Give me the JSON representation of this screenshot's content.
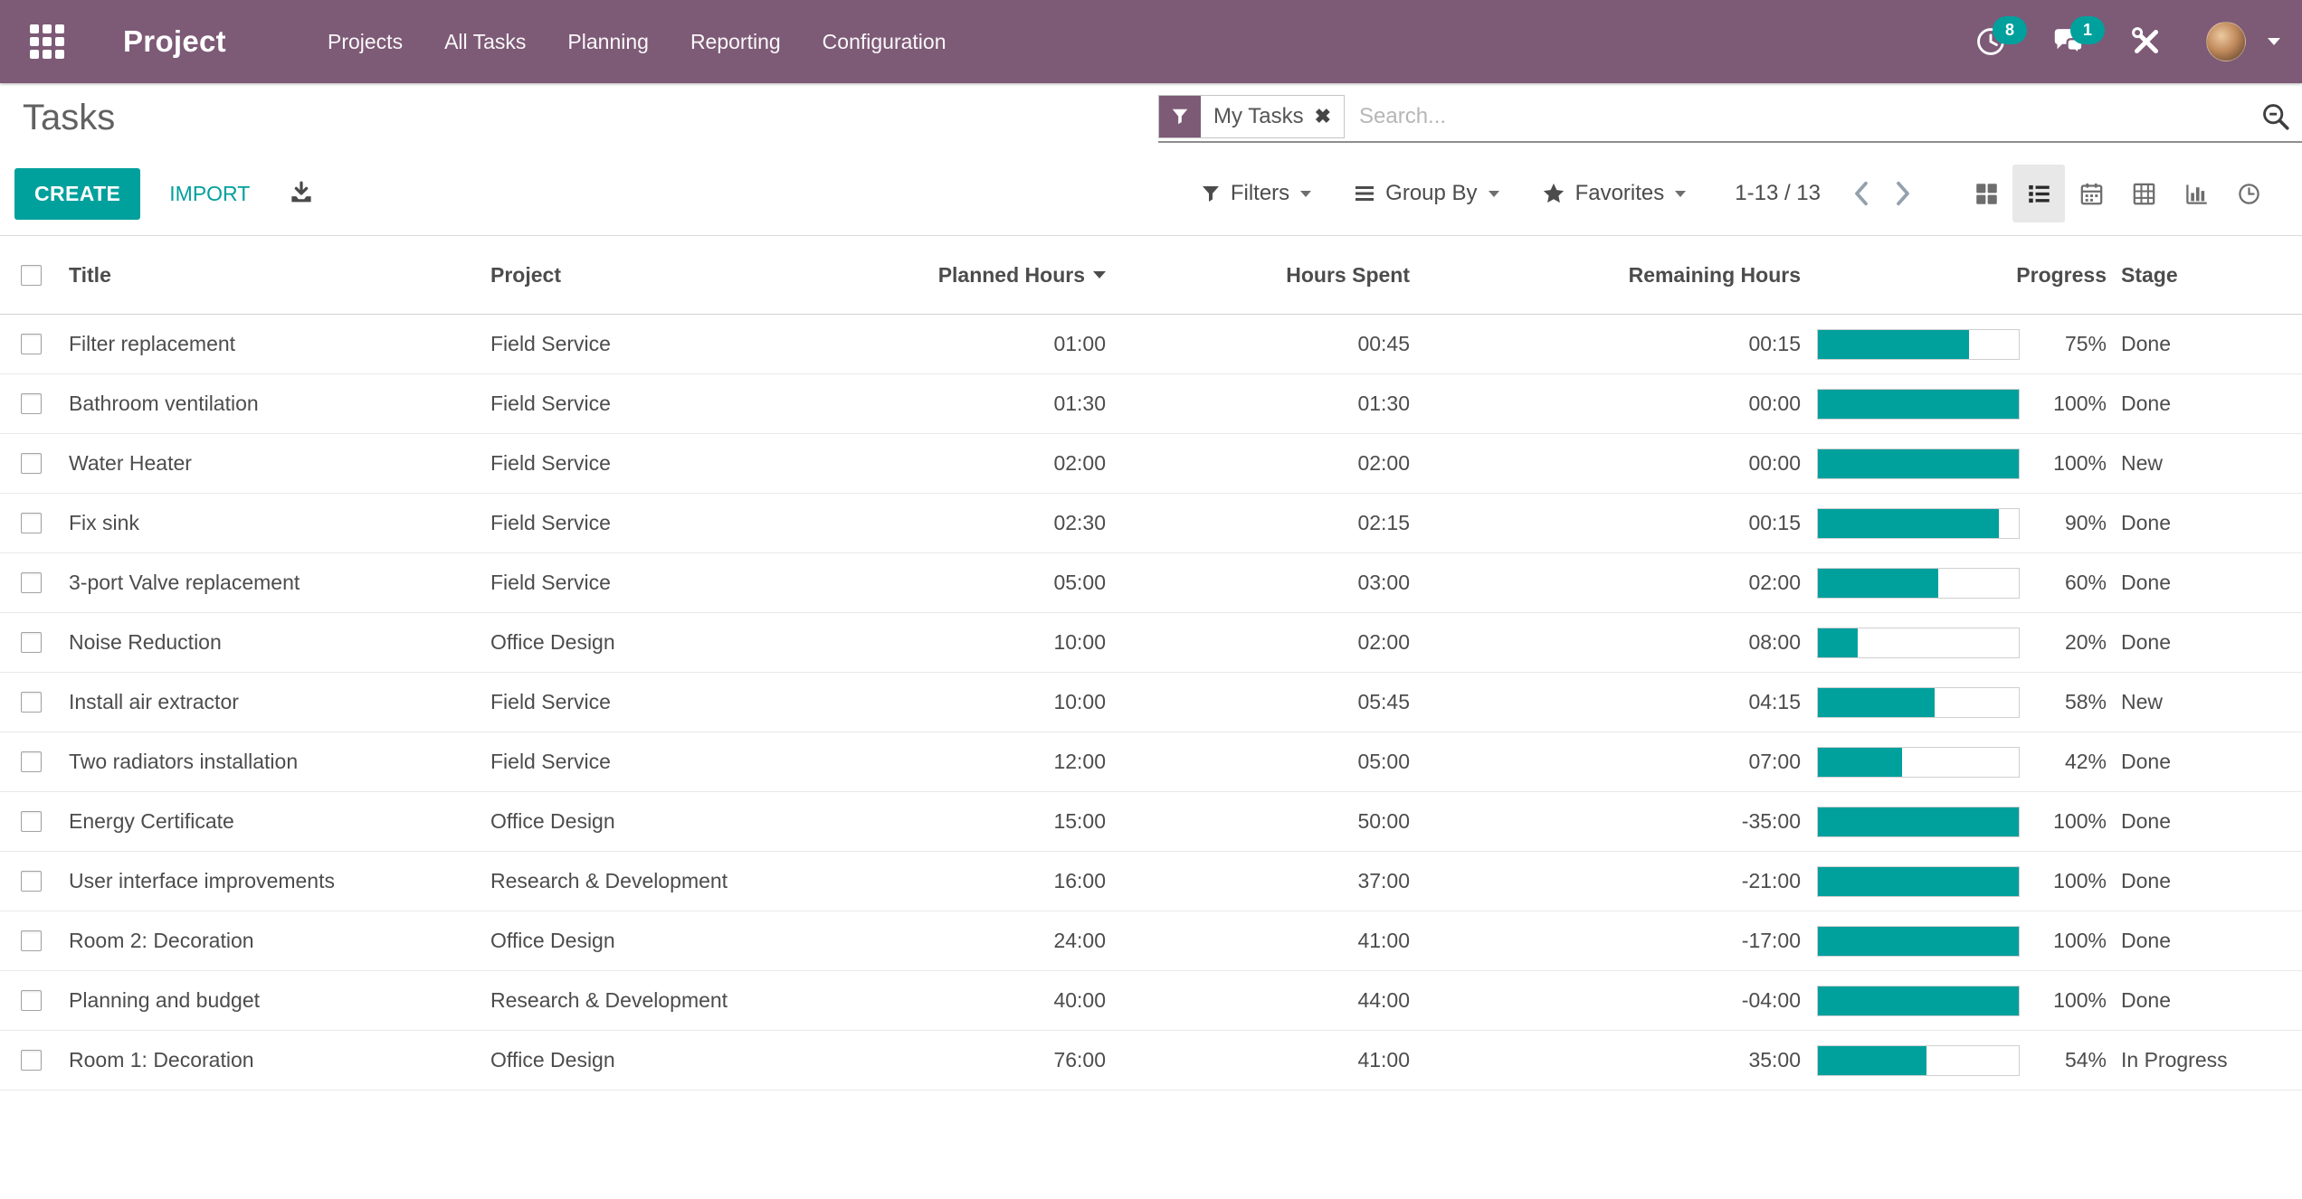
{
  "navbar": {
    "brand": "Project",
    "menus": [
      "Projects",
      "All Tasks",
      "Planning",
      "Reporting",
      "Configuration"
    ],
    "badges": {
      "activities": "8",
      "messages": "1"
    }
  },
  "control_panel": {
    "breadcrumb": "Tasks",
    "search": {
      "facet": "My Tasks",
      "placeholder": "Search..."
    },
    "buttons": {
      "create": "CREATE",
      "import": "IMPORT"
    },
    "dropdowns": {
      "filters": "Filters",
      "group_by": "Group By",
      "favorites": "Favorites"
    },
    "pager": {
      "range": "1-13 / 13"
    }
  },
  "table": {
    "headers": {
      "title": "Title",
      "project": "Project",
      "planned": "Planned Hours",
      "spent": "Hours Spent",
      "remaining": "Remaining Hours",
      "progress": "Progress",
      "stage": "Stage"
    },
    "sorted_by": "Planned Hours",
    "sort_direction": "desc",
    "rows": [
      {
        "title": "Filter replacement",
        "project": "Field Service",
        "planned": "01:00",
        "spent": "00:45",
        "remaining": "00:15",
        "progress": 75,
        "progress_label": "75%",
        "stage": "Done"
      },
      {
        "title": "Bathroom ventilation",
        "project": "Field Service",
        "planned": "01:30",
        "spent": "01:30",
        "remaining": "00:00",
        "progress": 100,
        "progress_label": "100%",
        "stage": "Done"
      },
      {
        "title": "Water Heater",
        "project": "Field Service",
        "planned": "02:00",
        "spent": "02:00",
        "remaining": "00:00",
        "progress": 100,
        "progress_label": "100%",
        "stage": "New"
      },
      {
        "title": "Fix sink",
        "project": "Field Service",
        "planned": "02:30",
        "spent": "02:15",
        "remaining": "00:15",
        "progress": 90,
        "progress_label": "90%",
        "stage": "Done"
      },
      {
        "title": "3-port Valve replacement",
        "project": "Field Service",
        "planned": "05:00",
        "spent": "03:00",
        "remaining": "02:00",
        "progress": 60,
        "progress_label": "60%",
        "stage": "Done"
      },
      {
        "title": "Noise Reduction",
        "project": "Office Design",
        "planned": "10:00",
        "spent": "02:00",
        "remaining": "08:00",
        "progress": 20,
        "progress_label": "20%",
        "stage": "Done"
      },
      {
        "title": "Install air extractor",
        "project": "Field Service",
        "planned": "10:00",
        "spent": "05:45",
        "remaining": "04:15",
        "progress": 58,
        "progress_label": "58%",
        "stage": "New"
      },
      {
        "title": "Two radiators installation",
        "project": "Field Service",
        "planned": "12:00",
        "spent": "05:00",
        "remaining": "07:00",
        "progress": 42,
        "progress_label": "42%",
        "stage": "Done"
      },
      {
        "title": "Energy Certificate",
        "project": "Office Design",
        "planned": "15:00",
        "spent": "50:00",
        "remaining": "-35:00",
        "progress": 100,
        "progress_label": "100%",
        "stage": "Done"
      },
      {
        "title": "User interface improvements",
        "project": "Research & Development",
        "planned": "16:00",
        "spent": "37:00",
        "remaining": "-21:00",
        "progress": 100,
        "progress_label": "100%",
        "stage": "Done"
      },
      {
        "title": "Room 2: Decoration",
        "project": "Office Design",
        "planned": "24:00",
        "spent": "41:00",
        "remaining": "-17:00",
        "progress": 100,
        "progress_label": "100%",
        "stage": "Done"
      },
      {
        "title": "Planning and budget",
        "project": "Research & Development",
        "planned": "40:00",
        "spent": "44:00",
        "remaining": "-04:00",
        "progress": 100,
        "progress_label": "100%",
        "stage": "Done"
      },
      {
        "title": "Room 1: Decoration",
        "project": "Office Design",
        "planned": "76:00",
        "spent": "41:00",
        "remaining": "35:00",
        "progress": 54,
        "progress_label": "54%",
        "stage": "In Progress"
      }
    ]
  },
  "icons": {
    "apps": "grid-3x3",
    "activities": "clock",
    "messages": "chat-bubbles",
    "tools": "crossed-tools",
    "user_menu": "caret-down",
    "search": "magnifier-minus",
    "facet": "funnel",
    "filters": "funnel",
    "group_by": "bars",
    "favorites": "star",
    "export": "download-tray",
    "sort": "caret-down",
    "views": [
      "kanban",
      "list",
      "calendar",
      "pivot",
      "graph",
      "activity"
    ]
  },
  "colors": {
    "navbar_bg": "#7d5a76",
    "accent": "#00a09d",
    "text": "#4c4c4c",
    "row_border": "#e9e9e9"
  }
}
